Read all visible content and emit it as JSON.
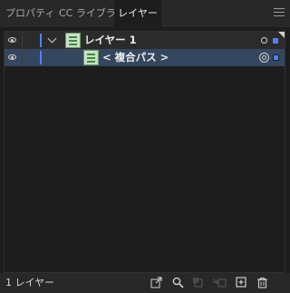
{
  "tabs": [
    {
      "label": "プロパティ"
    },
    {
      "label": "CC ライブラリ"
    },
    {
      "label": "レイヤー",
      "active": true
    }
  ],
  "panel_menu_icon": "hamburger-icon",
  "layers": [
    {
      "name": "レイヤー 1",
      "expanded": true,
      "visible": true,
      "color": "#4c84ff"
    },
    {
      "name": "< 複合パス >",
      "selected": true,
      "visible": true,
      "color": "#4c84ff"
    }
  ],
  "footer": {
    "count_label": "1 レイヤー",
    "icons": [
      "export-icon",
      "search-icon",
      "clipping-mask-icon",
      "new-sublayer-icon",
      "new-layer-icon",
      "trash-icon"
    ]
  },
  "colors": {
    "background": "#1d1d1d",
    "selection_row": "#35475e",
    "layer_color": "#4c84ff"
  }
}
